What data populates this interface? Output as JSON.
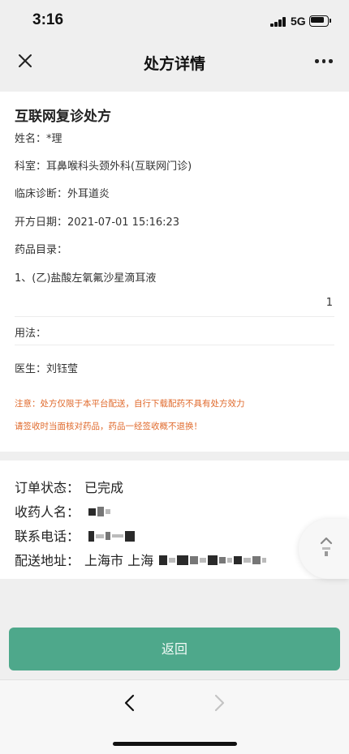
{
  "status_bar": {
    "time": "3:16",
    "network": "5G"
  },
  "nav": {
    "title": "处方详情",
    "close_icon": "close-icon",
    "more_icon": "more-icon"
  },
  "prescription": {
    "title": "互联网复诊处方",
    "name": "姓名：*理",
    "department": "科室：耳鼻喉科头颈外科(互联网门诊)",
    "diagnosis": "临床诊断：外耳道炎",
    "date": "开方日期：2021-07-01 15:16:23",
    "drug_list_label": "药品目录：",
    "drug_item": "1、(乙)盐酸左氧氟沙星滴耳液",
    "drug_qty": "1",
    "usage": "用法：",
    "doctor": "医生：刘钰莹",
    "notice_1": "注意：处方仅限于本平台配送，自行下载配药不具有处方效力",
    "notice_2": "请签收时当面核对药品，药品一经签收概不退换！",
    "notice_color": "#e06a2c"
  },
  "order": {
    "status_label": "订单状态：",
    "status_value": "已完成",
    "recipient_label": "收药人名：",
    "phone_label": "联系电话：",
    "address_label": "配送地址：",
    "address_value": "上海市 上海"
  },
  "buttons": {
    "return_label": "返回",
    "return_color": "#4ea88b"
  },
  "bottom_bar": {
    "back_icon": "back-arrow-icon",
    "forward_icon": "forward-arrow-icon"
  }
}
